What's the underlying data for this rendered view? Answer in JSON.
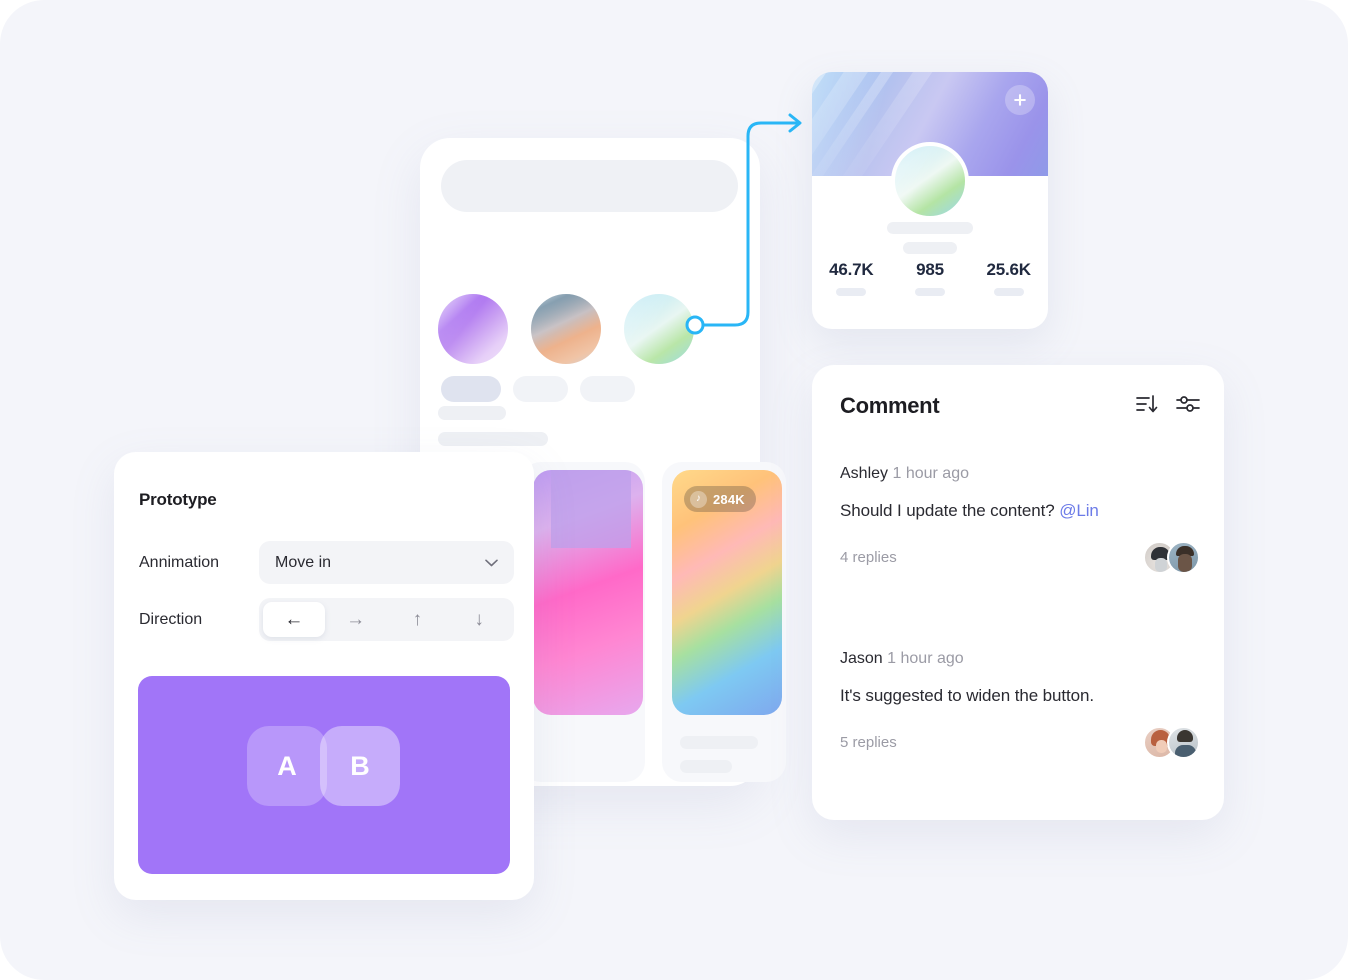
{
  "theme": {
    "page_background": "#F4F5FA",
    "accent_purple": "#A175F8",
    "accent_cyan": "#29B6F6",
    "mention_blue": "#6C7BE8",
    "stat_navy": "#20293F",
    "muted_text": "#9B9BA5"
  },
  "phone": {
    "search_placeholder": "",
    "chips": [
      "",
      "",
      ""
    ],
    "orbs": [
      "purple-gradient-orb",
      "peach-slate-gradient-orb",
      "mint-cyan-gradient-orb"
    ],
    "media_cards": [
      {
        "name": "pink-gradient-card",
        "badge": null
      },
      {
        "name": "rainbow-gradient-card",
        "badge": {
          "icon": "music-note-icon",
          "label": "284K"
        }
      }
    ]
  },
  "profile_card": {
    "add_button_icon": "plus-icon",
    "avatar_name": "mint-gradient-avatar",
    "stats": [
      {
        "value": "46.7K"
      },
      {
        "value": "985"
      },
      {
        "value": "25.6K"
      }
    ]
  },
  "connector": {
    "node_label": "link-node",
    "color": "#29B6F6"
  },
  "comment_card": {
    "title": "Comment",
    "actions": [
      {
        "name": "sort-icon",
        "label": "Sort"
      },
      {
        "name": "filter-sliders-icon",
        "label": "Filter"
      }
    ],
    "threads": [
      {
        "author": "Ashley",
        "time": "1 hour ago",
        "text_before_mention": "Should I update the content? ",
        "mention": "@Lin",
        "replies": "4 replies",
        "avatars": [
          "avatar-hat-person",
          "avatar-bearded-person"
        ]
      },
      {
        "author": "Jason",
        "time": "1 hour ago",
        "text_before_mention": "It's suggested to widen the button.",
        "mention": "",
        "replies": "5 replies",
        "avatars": [
          "avatar-woman-red-hair",
          "avatar-man-blue-shirt"
        ]
      }
    ]
  },
  "prototype_panel": {
    "title": "Prototype",
    "animation_label": "Annimation",
    "animation_value": "Move in",
    "animation_chevron": "chevron-down-icon",
    "direction_label": "Direction",
    "directions": [
      {
        "icon": "arrow-left-icon",
        "glyph": "←",
        "selected": true
      },
      {
        "icon": "arrow-right-icon",
        "glyph": "→",
        "selected": false
      },
      {
        "icon": "arrow-up-icon",
        "glyph": "↑",
        "selected": false
      },
      {
        "icon": "arrow-down-icon",
        "glyph": "↓",
        "selected": false
      }
    ],
    "preview": {
      "card_a": "A",
      "card_b": "B"
    }
  }
}
